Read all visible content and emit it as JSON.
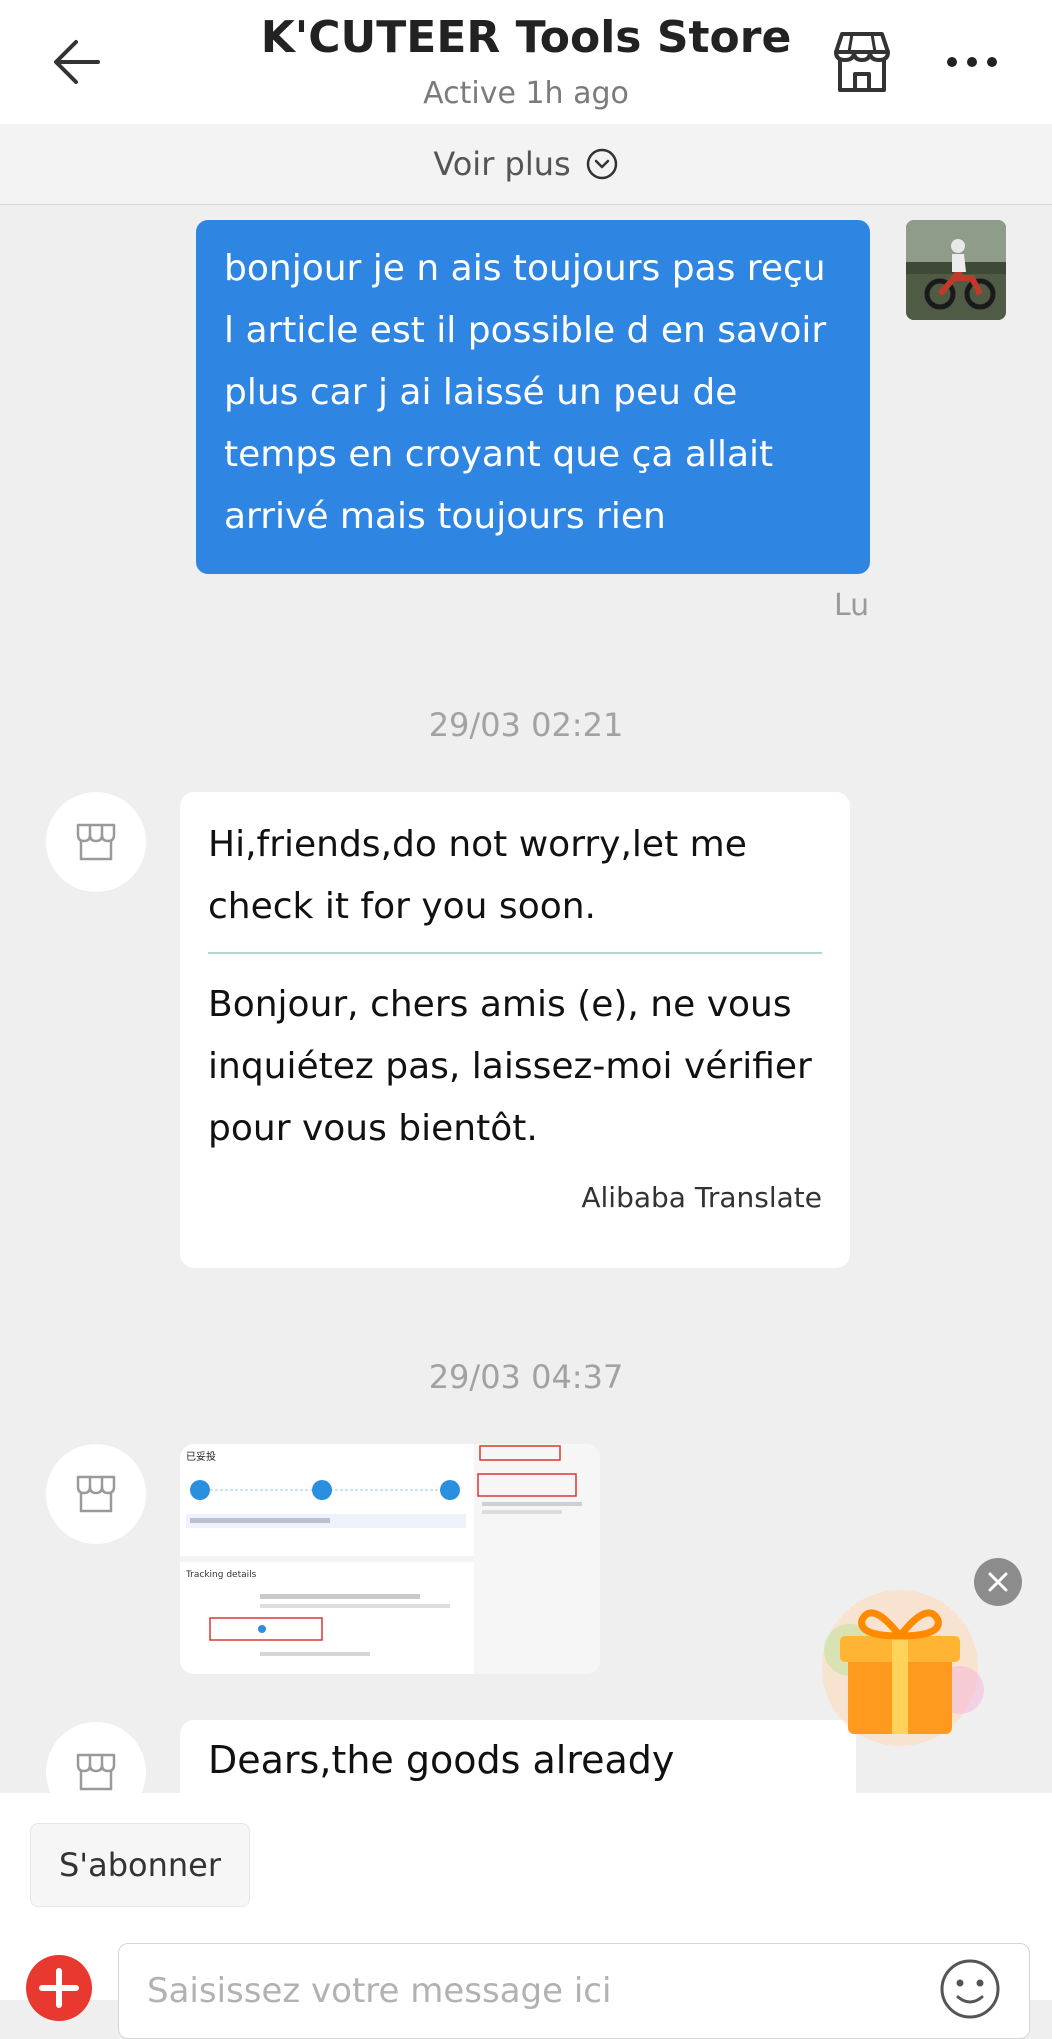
{
  "header": {
    "title": "K'CUTEER Tools Store",
    "status": "Active 1h ago",
    "back_icon": "arrow-left-icon",
    "store_icon": "storefront-icon",
    "more_icon": "more-dots-icon"
  },
  "see_more": {
    "label": "Voir plus",
    "icon": "chevron-down-circle-icon"
  },
  "messages": [
    {
      "from": "user",
      "text": "bonjour je n ais toujours pas reçu l article est il possible d en savoir plus car j ai laissé un peu de temps en croyant que ça allait arrivé mais toujours rien",
      "read_label": "Lu"
    },
    {
      "timestamp": "29/03 02:21",
      "from": "store",
      "original": "Hi,friends,do not worry,let me check it for you soon.",
      "translated": "Bonjour, chers amis (e), ne vous inquiétez pas, laissez-moi vérifier pour vous bientôt.",
      "translator": "Alibaba Translate"
    },
    {
      "timestamp": "29/03 04:37",
      "from": "store",
      "type": "image",
      "image_header": "已妥投",
      "image_section": "Tracking details"
    },
    {
      "from": "store",
      "text_partial": "Dears,the goods already"
    }
  ],
  "promo": {
    "icon": "gift-icon",
    "close_icon": "close-icon"
  },
  "footer": {
    "subscribe_label": "S'abonner",
    "input_placeholder": "Saisissez votre message ici",
    "add_icon": "plus-icon",
    "emoji_icon": "emoji-icon"
  },
  "colors": {
    "outgoing_bubble": "#2f86e2",
    "accent": "#e8382f",
    "background": "#efefef"
  }
}
